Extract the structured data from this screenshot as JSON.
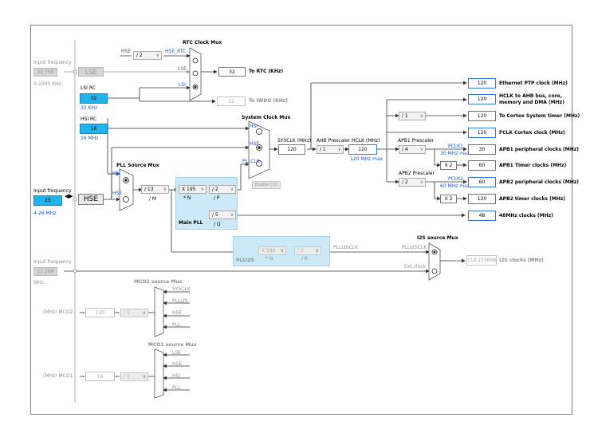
{
  "inputs": {
    "lse": {
      "label": "Input frequency",
      "value": "32.768",
      "range": "0-1000 KHz",
      "source": "LSE"
    },
    "lsi": {
      "label": "LSI RC",
      "value": "32",
      "unit": "32 KHz"
    },
    "hsi": {
      "label": "HSI RC",
      "value": "16",
      "unit": "16 MHz"
    },
    "hse": {
      "label": "Input frequency",
      "value": "25",
      "range": "4-26 MHz",
      "source": "HSE"
    },
    "ext": {
      "label": "Input frequency",
      "value": "12.288",
      "unit": "MHz"
    }
  },
  "rtc": {
    "title": "RTC Clock Mux",
    "div": "/ 2",
    "hse_label": "HSE",
    "hse_rtc": "HSE_RTC",
    "lse": "LSE",
    "lsi": "LSI",
    "value": "32",
    "out": "To RTC (KHz)"
  },
  "iwdg": {
    "value": "32",
    "out": "To IWDG (KHz)"
  },
  "sysmux": {
    "title": "System Clock Mux",
    "hsi": "HSI",
    "hse": "HSE",
    "pllclk": "PLLCLK",
    "css": "Enable CSS"
  },
  "pllsrc": {
    "title": "PLL Source Mux",
    "hsi": "HSI",
    "hse": "HSE"
  },
  "pll": {
    "m": "/ 13",
    "m_label": "/ M",
    "n": "X 195",
    "n_label": "* N",
    "p": "/ 2",
    "p_label": "/ P",
    "q": "/ 5",
    "q_label": "/ Q",
    "title": "Main PLL"
  },
  "plli2s": {
    "n": "X 192",
    "n_label": "* N",
    "r": "/ 2",
    "r_label": "/ R",
    "title": "PLLI2S",
    "clk": "PLLI2SCLK"
  },
  "sysclk": {
    "label": "SYSCLK (MHz)",
    "value": "120"
  },
  "ahb": {
    "label": "AHB Prescaler",
    "value": "/ 1"
  },
  "hclk": {
    "label": "HCLK (MHz)",
    "value": "120",
    "max": "120 MHz max"
  },
  "apb1": {
    "label": "APB1 Prescaler",
    "value": "/ 4",
    "pclk": "PCLK1",
    "max": "30 MHz max",
    "x2": "X 2"
  },
  "apb2": {
    "label": "APB2 Prescaler",
    "value": "/ 2",
    "pclk": "PCLK2",
    "max": "60 MHz max",
    "x2": "X 2"
  },
  "cortex_div": "/ 1",
  "outputs": [
    {
      "value": "120",
      "label": "Ethernet PTP clock (MHz)"
    },
    {
      "value": "120",
      "label": "HCLK to AHB bus, core,"
    },
    {
      "value": "120",
      "label": "To Cortex System timer (MHz)"
    },
    {
      "value": "120",
      "label": "FCLK Cortex clock (MHz)"
    },
    {
      "value": "30",
      "label": "APB1 peripheral clocks (MHz)"
    },
    {
      "value": "60",
      "label": "APB1 Timer clocks (MHz)"
    },
    {
      "value": "60",
      "label": "APB2 peripheral clocks (MHz)"
    },
    {
      "value": "120",
      "label": "APB2 timer clocks (MHz)"
    },
    {
      "value": "48",
      "label": "48MHz clocks (MHz)"
    }
  ],
  "hclk_line2": "memory and DMA (MHz)",
  "i2s": {
    "title": "I2S source Mux",
    "pll": "PLLI2SCLK",
    "ext": "Ext.clock",
    "value": "118.153846",
    "out": "I2S clocks (MHz)"
  },
  "mco2": {
    "title": "MCO2 source Mux",
    "sources": [
      "SYSCLK",
      "PLLI2S",
      "HSE",
      "PLL"
    ],
    "div": "/ 1",
    "value": "120",
    "label": "(MHz) MCO2"
  },
  "mco1": {
    "title": "MCO1 source Mux",
    "sources": [
      "LSE",
      "HSE",
      "HSI",
      "PLL"
    ],
    "div": "/ 1",
    "value": "16",
    "label": "(MHz) MCO1"
  }
}
